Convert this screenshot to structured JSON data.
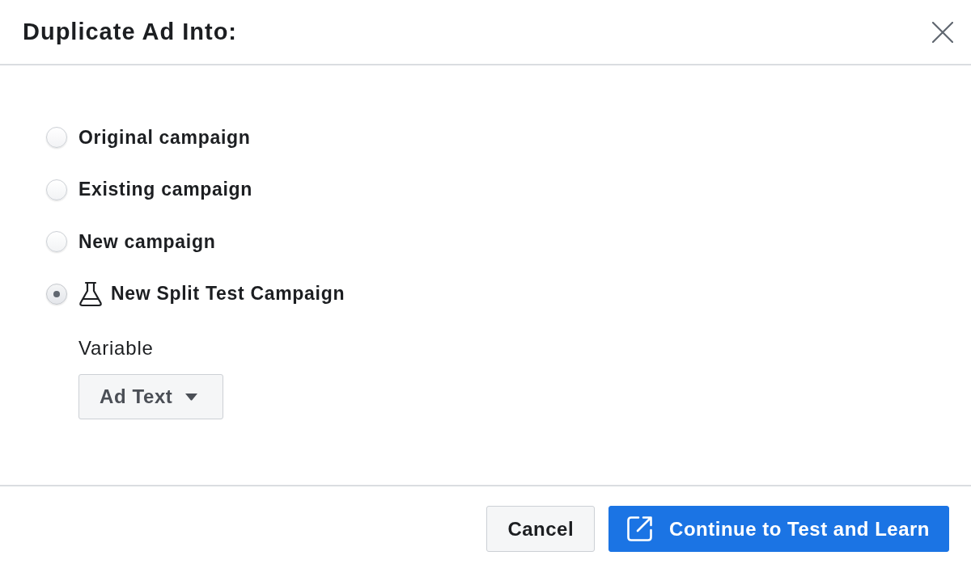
{
  "dialog": {
    "title": "Duplicate Ad Into:"
  },
  "options": [
    {
      "label": "Original campaign",
      "selected": false,
      "kind": "plain"
    },
    {
      "label": "Existing campaign",
      "selected": false,
      "kind": "plain"
    },
    {
      "label": "New campaign",
      "selected": false,
      "kind": "plain"
    },
    {
      "label": "New Split Test Campaign",
      "selected": true,
      "kind": "split_test"
    }
  ],
  "variable": {
    "label": "Variable",
    "dropdown": {
      "value": "Ad Text"
    }
  },
  "buttons": [
    {
      "label": "Cancel",
      "kind": "secondary"
    },
    {
      "label": "Continue to Test and Learn",
      "kind": "primary"
    }
  ]
}
